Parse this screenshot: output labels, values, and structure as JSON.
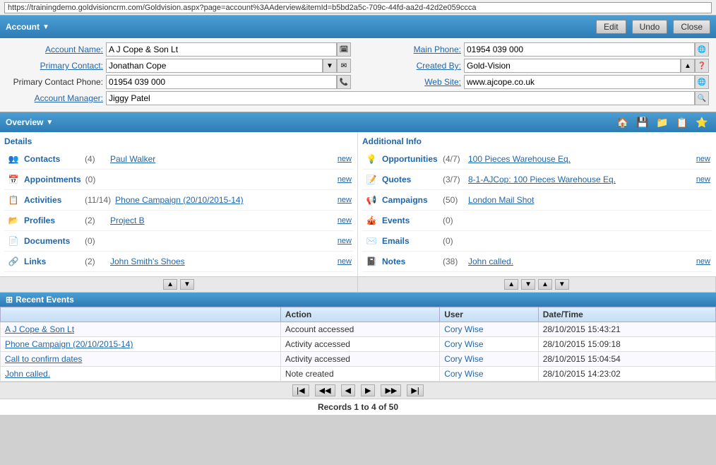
{
  "addressBar": {
    "url": "https://trainingdemo.goldvisioncrm.com/Goldvision.aspx?page=account%3AAderview&itemId=b5bd2a5c-709c-44fd-aa2d-42d2e059ccca"
  },
  "header": {
    "title": "Account",
    "edit_label": "Edit",
    "undo_label": "Undo",
    "close_label": "Close"
  },
  "form": {
    "account_name_label": "Account Name:",
    "account_name_value": "A J Cope & Son Lt",
    "primary_contact_label": "Primary Contact:",
    "primary_contact_value": "Jonathan Cope",
    "primary_contact_phone_label": "Primary Contact Phone:",
    "primary_contact_phone_value": "01954 039 000",
    "account_manager_label": "Account Manager:",
    "account_manager_value": "Jiggy Patel",
    "main_phone_label": "Main Phone:",
    "main_phone_value": "01954 039 000",
    "created_by_label": "Created By:",
    "created_by_value": "Gold-Vision",
    "web_site_label": "Web Site:",
    "web_site_value": "www.ajcope.co.uk"
  },
  "overview": {
    "title": "Overview",
    "left_title": "Details",
    "right_title": "Additional Info",
    "left_items": [
      {
        "label": "Contacts",
        "count": "(4)",
        "link": "Paul Walker",
        "new": "new",
        "icon": "👥"
      },
      {
        "label": "Appointments",
        "count": "(0)",
        "link": "",
        "new": "new",
        "icon": "📅"
      },
      {
        "label": "Activities",
        "count": "(11/14)",
        "link": "Phone Campaign (20/10/2015-14)",
        "new": "new",
        "icon": "📋"
      },
      {
        "label": "Profiles",
        "count": "(2)",
        "link": "Project B",
        "new": "new",
        "icon": "📂"
      },
      {
        "label": "Documents",
        "count": "(0)",
        "link": "",
        "new": "new",
        "icon": "📄"
      },
      {
        "label": "Links",
        "count": "(2)",
        "link": "John Smith's Shoes",
        "new": "new",
        "icon": "🔗"
      }
    ],
    "right_items": [
      {
        "label": "Opportunities",
        "count": "(4/7)",
        "link": "100 Pieces Warehouse Eq.",
        "new": "new",
        "icon": "💡"
      },
      {
        "label": "Quotes",
        "count": "(3/7)",
        "link": "8-1-AJCop: 100 Pieces Warehouse Eq.",
        "new": "new",
        "icon": "📝"
      },
      {
        "label": "Campaigns",
        "count": "(50)",
        "link": "London Mail Shot",
        "new": "",
        "icon": "📢"
      },
      {
        "label": "Events",
        "count": "(0)",
        "link": "",
        "new": "",
        "icon": "🎪"
      },
      {
        "label": "Emails",
        "count": "(0)",
        "link": "",
        "new": "",
        "icon": "✉️"
      },
      {
        "label": "Notes",
        "count": "(38)",
        "link": "John called.",
        "new": "new",
        "icon": "📓"
      }
    ]
  },
  "recentEvents": {
    "title": "Recent Events",
    "columns": [
      "Action",
      "User",
      "Date/Time"
    ],
    "rows": [
      {
        "name": "A J Cope & Son Lt",
        "action": "Account accessed",
        "user": "Cory Wise",
        "datetime": "28/10/2015 15:43:21"
      },
      {
        "name": "Phone Campaign (20/10/2015-14)",
        "action": "Activity accessed",
        "user": "Cory Wise",
        "datetime": "28/10/2015 15:09:18"
      },
      {
        "name": "Call to confirm dates",
        "action": "Activity accessed",
        "user": "Cory Wise",
        "datetime": "28/10/2015 15:04:54"
      },
      {
        "name": "John called.",
        "action": "Note created",
        "user": "Cory Wise",
        "datetime": "28/10/2015 14:23:02"
      }
    ]
  },
  "pagination": {
    "records_info": "Records 1 to 4 of 50"
  },
  "toolbar": {
    "icons": [
      "🏠",
      "💾",
      "📁",
      "📋",
      "⭐"
    ]
  }
}
